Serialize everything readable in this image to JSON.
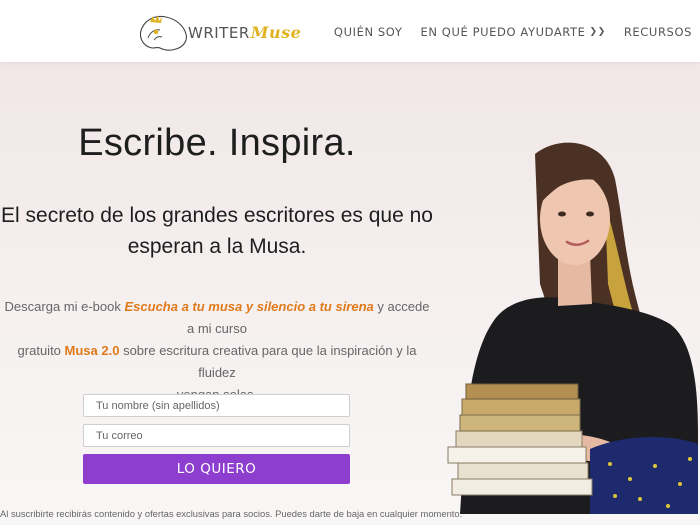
{
  "header": {
    "logo": {
      "word1": "WRITER",
      "word2": "Muse"
    },
    "nav": [
      {
        "label": "QUIÉN SOY",
        "has_dropdown": false
      },
      {
        "label": "EN QUÉ PUEDO AYUDARTE",
        "has_dropdown": true
      },
      {
        "label": "RECURSOS",
        "has_dropdown": false
      }
    ]
  },
  "hero": {
    "title": "Escribe. Inspira.",
    "subtitle_line1": "El secreto de los grandes escritores es que no",
    "subtitle_line2": "esperan a la Musa.",
    "desc": {
      "part1": "Descarga mi e-book ",
      "ebook": "Escucha a tu musa y silencio a tu sirena",
      "part2": " y accede a mi curso",
      "part3": "gratuito ",
      "course": "Musa 2.0",
      "part4": " sobre escritura creativa para que la inspiración y la fluidez",
      "part5": "vengan solas."
    },
    "form": {
      "name_placeholder": "Tu nombre (sin apellidos)",
      "email_placeholder": "Tu correo",
      "submit_label": "LO QUIERO"
    },
    "legal": "Al suscribirte recibirás contenido y ofertas exclusivas para socios. Puedes darte de baja en cualquier momento."
  },
  "colors": {
    "accent_purple": "#8e3ecf",
    "highlight_orange": "#e07a1a",
    "logo_gold": "#e0b31f",
    "hero_bg": "#f3eaea"
  },
  "icons": {
    "dropdown": "chevron-double-down-icon"
  }
}
